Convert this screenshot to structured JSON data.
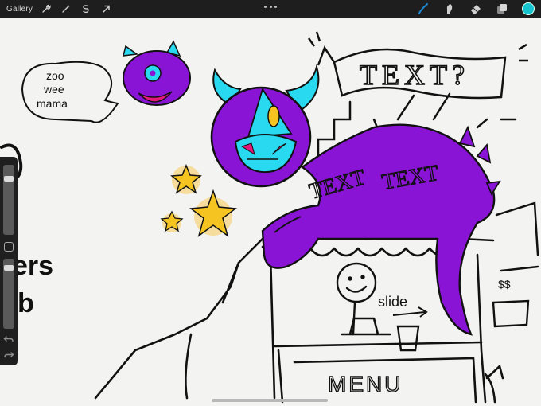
{
  "toolbar": {
    "gallery_label": "Gallery",
    "left_tools": [
      "wrench-icon",
      "magic-wand-icon",
      "selection-icon",
      "transform-arrow-icon"
    ],
    "right_tools": [
      "brush-icon",
      "smudge-icon",
      "eraser-icon",
      "layers-icon"
    ],
    "active_tool": "brush",
    "brush_color": "#1d8bd8",
    "current_color": "#17c3cf"
  },
  "canvas": {
    "bubble_lines": [
      "zoo",
      "wee",
      "mama"
    ],
    "banner_text": "TEXT?",
    "body_text_1": "TEXT",
    "body_text_2": "TEXT",
    "slide_label": "slide",
    "menu_label": "MENU",
    "price_mark": "$$",
    "left_edge_1": "ers",
    "left_edge_2": "b",
    "ink_color": "#111111",
    "purple": "#8a14d6",
    "cyan": "#29d9ef",
    "magenta": "#e3187a",
    "star_yellow": "#f5c420",
    "star_glow": "#f6d37a"
  },
  "sidebar": {
    "brush_size_level": 0.88,
    "opacity_level": 0.93
  }
}
